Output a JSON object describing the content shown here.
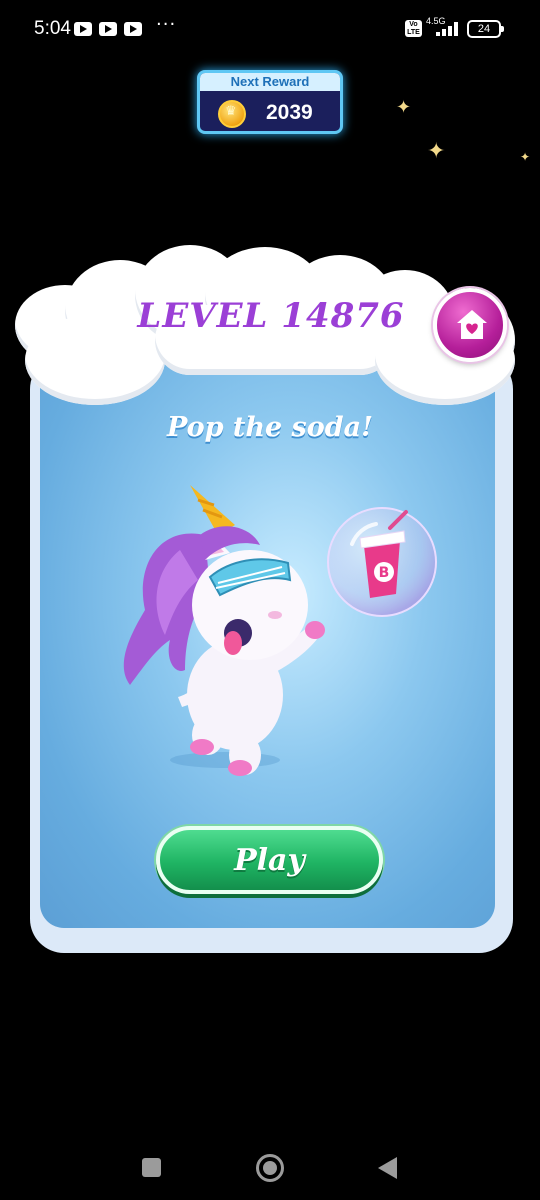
{
  "status_bar": {
    "time": "5:04",
    "notifications": [
      "youtube-icon",
      "youtube-icon",
      "youtube-icon"
    ],
    "more": "···",
    "volte": "Vo LTE",
    "network": "4.5G",
    "battery": "24"
  },
  "reward": {
    "label": "Next Reward",
    "value": "2039",
    "icon": "coin-icon"
  },
  "level": {
    "title": "LEVEL 14876",
    "subtitle": "Pop the soda!",
    "home_icon": "home-heart-icon",
    "play_label": "Play"
  },
  "colors": {
    "title": "#9b3fd6",
    "play_button": "#1fb463",
    "home_button": "#b51f9a",
    "card_background": "#66acdf"
  },
  "nav_bar": {
    "recent": "square-icon",
    "home": "circle-icon",
    "back": "triangle-back-icon"
  }
}
